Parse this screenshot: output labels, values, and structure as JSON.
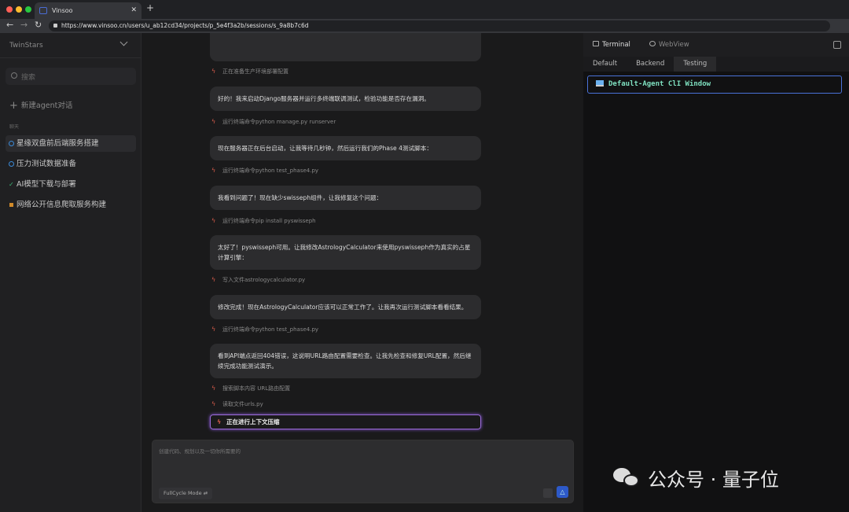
{
  "browser": {
    "tab_title": "Vinsoo",
    "url": "https://www.vinsoo.cn/users/u_ab12cd34/projects/p_5e4f3a2b/sessions/s_9a8b7c6d"
  },
  "sidebar": {
    "workspace": "TwinStars",
    "search_placeholder": "搜索",
    "new_chat": "新建agent对话",
    "section": "聊天",
    "items": [
      {
        "label": "星缘双盘前后端服务搭建",
        "status": "in-progress"
      },
      {
        "label": "压力测试数据准备",
        "status": "in-progress"
      },
      {
        "label": "AI模型下载与部署",
        "status": "done"
      },
      {
        "label": "网络公开信息爬取服务构建",
        "status": "paused"
      }
    ]
  },
  "chat": {
    "items": [
      {
        "type": "status",
        "text": "正在准备生产环境部署配置"
      },
      {
        "type": "bubble",
        "text": "好的！我来启动Django服务器并运行多终端联调测试，检验功能是否存在漏洞。"
      },
      {
        "type": "status",
        "text": "运行终端命令python manage.py runserver"
      },
      {
        "type": "bubble",
        "text": "现在服务器正在后台启动，让我等待几秒钟，然后运行我们的Phase 4测试脚本："
      },
      {
        "type": "status",
        "text": "运行终端命令python test_phase4.py"
      },
      {
        "type": "bubble",
        "text": "我看到问题了！现在缺少swisseph组件，让我修复这个问题："
      },
      {
        "type": "status",
        "text": "运行终端命令pip install pyswisseph"
      },
      {
        "type": "bubble",
        "text": "太好了！pyswisseph可用。让我修改AstrologyCalculator来使用pyswisseph作为真实的占星计算引擎："
      },
      {
        "type": "status",
        "text": "写入文件astrologycalculator.py"
      },
      {
        "type": "bubble",
        "text": "修改完成！现在AstrologyCalculator应该可以正常工作了。让我再次运行测试脚本看看结果。"
      },
      {
        "type": "status",
        "text": "运行终端命令python test_phase4.py"
      },
      {
        "type": "bubble",
        "text": "看到API端点返回404错误，这说明URL路由配置需要检查。让我先检查和修复URL配置，然后继续完成功能测试演示。"
      },
      {
        "type": "status",
        "text": "搜索脚本内容 URL路由配置"
      },
      {
        "type": "status",
        "text": "读取文件urls.py"
      },
      {
        "type": "active",
        "text": "正在进行上下文压缩"
      }
    ]
  },
  "input": {
    "placeholder": "创建代码、规划以及一切你所需要的",
    "mode": "FullCycle Mode"
  },
  "panel": {
    "tabs": [
      "Terminal",
      "WebView"
    ],
    "subtabs": [
      "Default",
      "Backend",
      "Testing"
    ],
    "selected_subtab": "Testing",
    "cli_title": "Default-Agent ClI Window"
  },
  "watermark": "公众号 · 量子位",
  "colors": {
    "accent": "#2d59c8",
    "active_border": "#9a6ad8",
    "cli_text": "#7fe0c0"
  }
}
